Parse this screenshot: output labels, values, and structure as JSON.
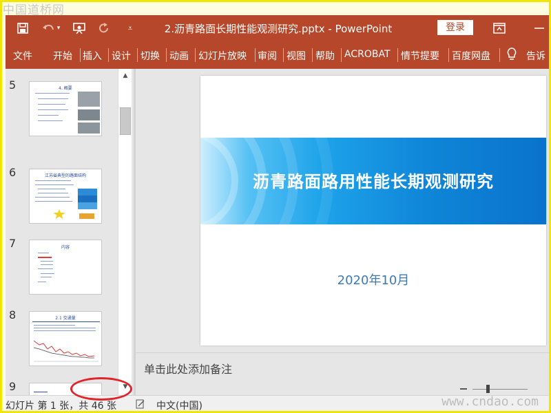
{
  "watermarks": {
    "top": "中国道桥网",
    "bottom": "www.cndao.com"
  },
  "titlebar": {
    "document_title": "2.沥青路面长期性能观测研究.pptx  -  PowerPoint",
    "login_label": "登录",
    "icons": [
      "save-icon",
      "undo-icon",
      "present-icon",
      "redo-icon",
      "customize-qat-icon",
      "ribbon-display-icon",
      "minimize-icon"
    ]
  },
  "ribbon": {
    "tabs": [
      "文件",
      "开始",
      "插入",
      "设计",
      "切换",
      "动画",
      "幻灯片放映",
      "审阅",
      "视图",
      "帮助",
      "ACROBAT",
      "情节提要",
      "百度网盘",
      "告诉"
    ]
  },
  "thumbnails": {
    "slides": [
      {
        "number": "5",
        "title": "4. 概要"
      },
      {
        "number": "6",
        "title": "江苏省典型的路面结构"
      },
      {
        "number": "7",
        "title": "内容"
      },
      {
        "number": "8",
        "title": "2.1 交通量"
      },
      {
        "number": "9",
        "title": ""
      }
    ]
  },
  "slide": {
    "title": "沥青路面路用性能长期观测研究",
    "date": "2020年10月",
    "banner_colors": [
      "#cdeeff",
      "#1ea3ea",
      "#0a73cc"
    ]
  },
  "notes": {
    "placeholder": "单击此处添加备注"
  },
  "statusbar": {
    "slide_count": "幻灯片 第 1 张，共 46 张",
    "language": "中文(中国)"
  },
  "colors": {
    "accent": "#b7472a",
    "annotation": "#e0242a"
  }
}
